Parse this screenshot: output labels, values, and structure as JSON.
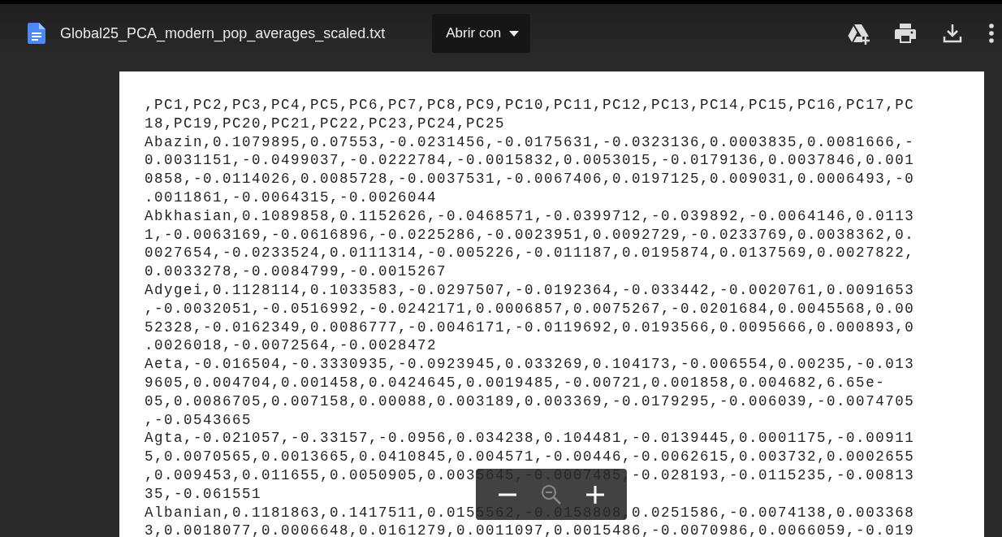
{
  "header": {
    "file_name": "Global25_PCA_modern_pop_averages_scaled.txt",
    "open_with": "Abrir con"
  },
  "document": {
    "lines": [
      ",PC1,PC2,PC3,PC4,PC5,PC6,PC7,PC8,PC9,PC10,PC11,PC12,PC13,PC14,PC15,PC16,PC17,PC",
      "18,PC19,PC20,PC21,PC22,PC23,PC24,PC25",
      "Abazin,0.1079895,0.07553,-0.0231456,-0.0175631,-0.0323136,0.0003835,0.0081666,-",
      "0.0031151,-0.0499037,-0.0222784,-0.0015832,0.0053015,-0.0179136,0.0037846,0.001",
      "0858,-0.0114026,0.0085728,-0.0037531,-0.0067406,0.0197125,0.009031,0.0006493,-0",
      ".0011861,-0.0064315,-0.0026044",
      "Abkhasian,0.1089858,0.1152626,-0.0468571,-0.0399712,-0.039892,-0.0064146,0.0113",
      "1,-0.0063169,-0.0616896,-0.0225286,-0.0023951,0.0092729,-0.0233769,0.0038362,0.",
      "0027654,-0.0233524,0.0111314,-0.005226,-0.011187,0.0195874,0.0137569,0.0027822,",
      "0.0033278,-0.0084799,-0.0015267",
      "Adygei,0.1128114,0.1033583,-0.0297507,-0.0192364,-0.033442,-0.0020761,0.0091653",
      ",-0.0032051,-0.0516992,-0.0242171,0.0006857,0.0075267,-0.0201684,0.0045568,0.00",
      "52328,-0.0162349,0.0086777,-0.0046171,-0.0119692,0.0193566,0.0095666,0.000893,0",
      ".0026018,-0.0072564,-0.0028472",
      "Aeta,-0.016504,-0.3330935,-0.0923945,0.033269,0.104173,-0.006554,0.00235,-0.013",
      "9605,0.004704,0.001458,0.0424645,0.0019485,-0.00721,0.001858,0.004682,6.65e-",
      "05,0.0086705,0.007158,0.00088,0.003189,0.003369,-0.0179295,-0.006039,-0.0074705",
      ",-0.0543665",
      "Agta,-0.021057,-0.33157,-0.0956,0.034238,0.104481,-0.0139445,0.0001175,-0.00911",
      "5,0.0070565,0.0013665,0.0410845,0.004571,-0.00446,-0.0062615,0.003732,0.0002655",
      ",0.009453,0.011655,0.0050905,0.0035645,-0.0007485,-0.028193,-0.0115235,-0.00813",
      "35,-0.061551",
      "Albanian,0.1181863,0.1417511,0.0155562,-0.0158808,0.0251586,-0.0074138,0.003368",
      "3,0.0018077,0.0006648,0.0161279,0.0011097,0.0015486,-0.0070986,0.0066059,-0.019"
    ]
  }
}
